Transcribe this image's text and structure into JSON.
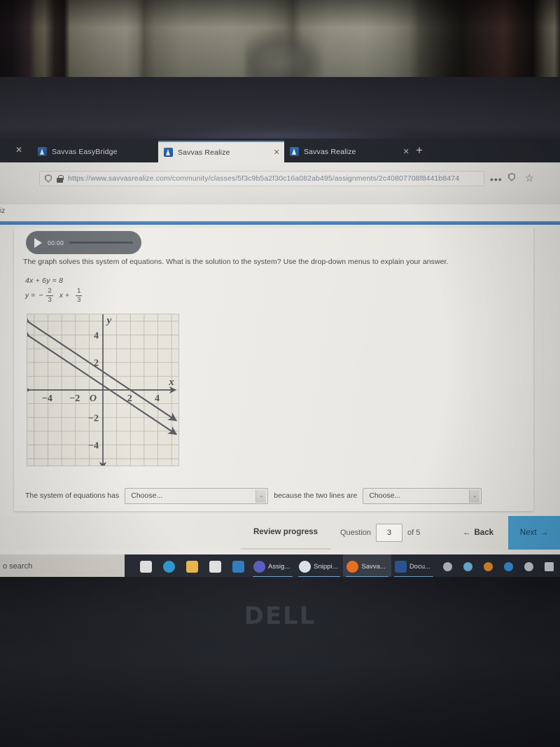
{
  "browser": {
    "tabs": [
      {
        "title": "Savvas EasyBridge",
        "close": "✕",
        "active": false
      },
      {
        "title": "Savvas Realize",
        "close": "✕",
        "active": true
      },
      {
        "title": "Savvas Realize",
        "close": "✕",
        "active": false
      }
    ],
    "left_close": "✕",
    "new_tab": "+",
    "url": "https://www.savvasrealize.com/community/classes/5f3c9b5a2f30c16a082ab495/assignments/2c40807708f8441b8474",
    "overflow_menu": "•••",
    "star": "☆"
  },
  "page": {
    "breadcrumb": "iz",
    "audio": {
      "time": "00:00",
      "play_label": "Play"
    },
    "prompt": "The graph solves this system of equations. What is the solution to the system? Use the drop-down menus to explain your answer.",
    "equations": {
      "line1": "4x + 6y = 8",
      "line2_lhs": "y =",
      "line2_sign": "−",
      "line2_frac1_num": "2",
      "line2_frac1_den": "3",
      "line2_mid": "x +",
      "line2_frac2_num": "1",
      "line2_frac2_den": "3"
    },
    "answer": {
      "text_before": "The system of equations has",
      "dropdown1_value": "Choose...",
      "text_middle": "because the two lines are",
      "dropdown2_value": "Choose...",
      "arrow": "⌄"
    }
  },
  "toolbar": {
    "review_label": "Review progress",
    "question_label": "Question",
    "question_number": "3",
    "of_label": "of 5",
    "back_label": "Back",
    "back_arrow": "←",
    "next_label": "Next",
    "next_arrow": "→",
    "next_color": "#4ba3d6"
  },
  "taskbar": {
    "search_placeholder": "o search",
    "items": [
      {
        "name": "task-view-icon",
        "label": "",
        "color": "#e8e8e8",
        "labeled": false
      },
      {
        "name": "edge-icon",
        "label": "",
        "color": "#2e9bd6",
        "labeled": false
      },
      {
        "name": "file-explorer-icon",
        "label": "",
        "color": "#f0b94c",
        "labeled": false
      },
      {
        "name": "microsoft-store-icon",
        "label": "",
        "color": "#e4e4e4",
        "labeled": false
      },
      {
        "name": "mail-icon",
        "label": "",
        "color": "#2f7fc4",
        "labeled": false
      },
      {
        "name": "teams-icon",
        "label": "Assig...",
        "color": "#5b5fc7",
        "labeled": true
      },
      {
        "name": "snipping-tool-icon",
        "label": "Snippi...",
        "color": "#dfe6ee",
        "labeled": true
      },
      {
        "name": "firefox-icon",
        "label": "Savva...",
        "color": "#f0721e",
        "labeled": true
      },
      {
        "name": "word-icon",
        "label": "Docu...",
        "color": "#2b579a",
        "labeled": true
      }
    ],
    "tray": [
      {
        "name": "volume-muted-icon",
        "color": "#b9bcc2"
      },
      {
        "name": "network-icon",
        "color": "#6fb5e0"
      },
      {
        "name": "onedrive-icon",
        "color": "#e08b2e"
      },
      {
        "name": "bluetooth-icon",
        "color": "#3a8fd8"
      },
      {
        "name": "dropbox-icon",
        "color": "#c8ccd2"
      },
      {
        "name": "battery-icon",
        "color": "#d4d7dc"
      }
    ]
  },
  "laptop": {
    "brand": "DELL"
  },
  "chart_data": {
    "type": "line",
    "title": "",
    "xlabel": "x",
    "ylabel": "y",
    "xlim": [
      -5.5,
      5.5
    ],
    "ylim": [
      -5.5,
      5.5
    ],
    "xticks": [
      -4,
      -2,
      0,
      2,
      4
    ],
    "yticks": [
      -4,
      -2,
      2,
      4
    ],
    "xtick_labels": [
      "−4",
      "−2",
      "O",
      "2",
      "4"
    ],
    "ytick_labels": [
      "−4",
      "−2",
      "2",
      "4"
    ],
    "grid": true,
    "origin_label": "O",
    "series": [
      {
        "name": "4x + 6y = 8",
        "slope": -0.6667,
        "intercept": 1.3333,
        "arrows": "both"
      },
      {
        "name": "y = -2/3 x + 1/3",
        "slope": -0.6667,
        "intercept": 0.3333,
        "arrows": "both"
      }
    ],
    "relationship": "parallel",
    "line_color": "#585c5e"
  }
}
